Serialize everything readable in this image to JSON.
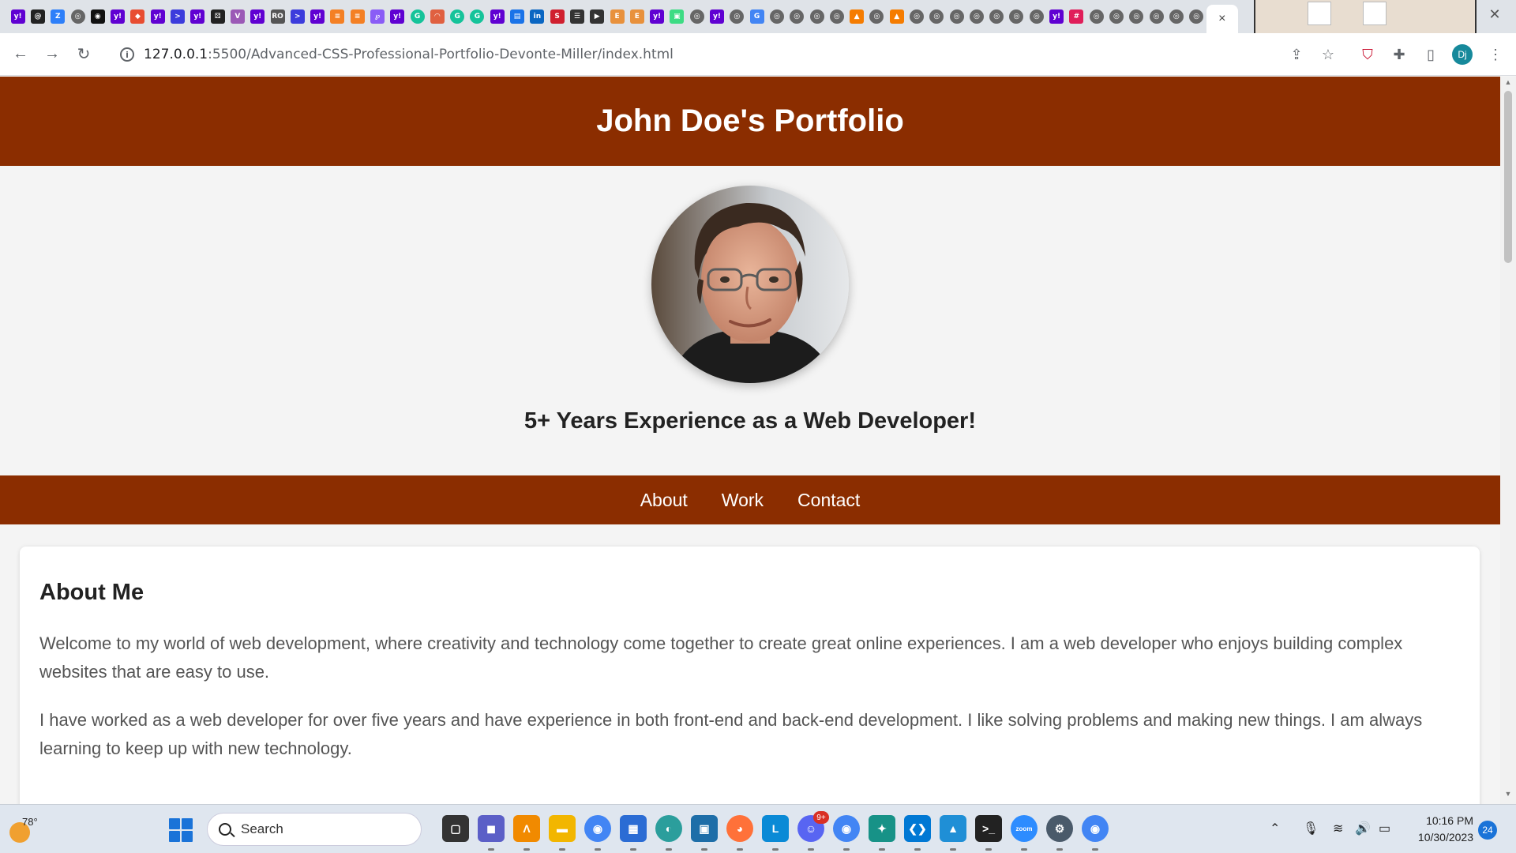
{
  "browser": {
    "tab_close_glyph": "×",
    "window_close_glyph": "✕",
    "url_host": "127.0.0.1",
    "url_path": ":5500/Advanced-CSS-Professional-Portfolio-Devonte-Miller/index.html",
    "profile_initials": "Dj",
    "tab_favicons": [
      {
        "icon": "yahoo-icon",
        "color": "#6001d2",
        "glyph": "y!"
      },
      {
        "icon": "spiral-icon",
        "color": "#222222",
        "glyph": "@"
      },
      {
        "icon": "z-icon",
        "color": "#2d7ff9",
        "glyph": "Z"
      },
      {
        "icon": "globe-icon",
        "color": "#666666",
        "glyph": "◎"
      },
      {
        "icon": "github-icon",
        "color": "#111111",
        "glyph": "◉"
      },
      {
        "icon": "yahoo-icon",
        "color": "#6001d2",
        "glyph": "y!"
      },
      {
        "icon": "git-icon",
        "color": "#e84d31",
        "glyph": "◆"
      },
      {
        "icon": "yahoo-icon",
        "color": "#6001d2",
        "glyph": "y!"
      },
      {
        "icon": "terminal-icon",
        "color": "#3c3cdc",
        "glyph": ">"
      },
      {
        "icon": "yahoo-icon",
        "color": "#6001d2",
        "glyph": "y!"
      },
      {
        "icon": "dice-icon",
        "color": "#222222",
        "glyph": "⚄"
      },
      {
        "icon": "vuetify-icon",
        "color": "#9b59b6",
        "glyph": "V"
      },
      {
        "icon": "yahoo-icon",
        "color": "#6001d2",
        "glyph": "y!"
      },
      {
        "icon": "ro-icon",
        "color": "#555555",
        "glyph": "RO"
      },
      {
        "icon": "terminal-icon",
        "color": "#3c3cdc",
        "glyph": ">"
      },
      {
        "icon": "yahoo-icon",
        "color": "#6001d2",
        "glyph": "y!"
      },
      {
        "icon": "stack-icon",
        "color": "#f48024",
        "glyph": "≡"
      },
      {
        "icon": "stack-icon",
        "color": "#f48024",
        "glyph": "≡"
      },
      {
        "icon": "regex-icon",
        "color": "#8a5cf6",
        "glyph": "℘"
      },
      {
        "icon": "yahoo-icon",
        "color": "#6001d2",
        "glyph": "y!"
      },
      {
        "icon": "grammarly-icon",
        "color": "#15c39a",
        "glyph": "G"
      },
      {
        "icon": "rainbow-icon",
        "color": "#e06040",
        "glyph": "◠"
      },
      {
        "icon": "grammarly-icon",
        "color": "#15c39a",
        "glyph": "G"
      },
      {
        "icon": "grammarly-icon",
        "color": "#15c39a",
        "glyph": "G"
      },
      {
        "icon": "yahoo-icon",
        "color": "#6001d2",
        "glyph": "y!"
      },
      {
        "icon": "doc-icon",
        "color": "#1a73e8",
        "glyph": "▤"
      },
      {
        "icon": "linkedin-icon",
        "color": "#0a66c2",
        "glyph": "in"
      },
      {
        "icon": "s-icon",
        "color": "#d0202f",
        "glyph": "S"
      },
      {
        "icon": "list-icon",
        "color": "#333333",
        "glyph": "☰"
      },
      {
        "icon": "play-icon",
        "color": "#333333",
        "glyph": "▶"
      },
      {
        "icon": "e-icon",
        "color": "#e8913c",
        "glyph": "E"
      },
      {
        "icon": "e-icon",
        "color": "#e8913c",
        "glyph": "E"
      },
      {
        "icon": "yahoo-icon",
        "color": "#6001d2",
        "glyph": "y!"
      },
      {
        "icon": "android-icon",
        "color": "#3ddc84",
        "glyph": "▣"
      },
      {
        "icon": "globe-icon",
        "color": "#666666",
        "glyph": "◎"
      },
      {
        "icon": "yahoo-icon",
        "color": "#6001d2",
        "glyph": "y!"
      },
      {
        "icon": "globe-icon",
        "color": "#666666",
        "glyph": "◎"
      },
      {
        "icon": "google-icon",
        "color": "#4285f4",
        "glyph": "G"
      },
      {
        "icon": "globe-icon",
        "color": "#666666",
        "glyph": "◎"
      },
      {
        "icon": "globe-icon",
        "color": "#666666",
        "glyph": "◎"
      },
      {
        "icon": "globe-icon",
        "color": "#666666",
        "glyph": "◎"
      },
      {
        "icon": "globe-icon",
        "color": "#666666",
        "glyph": "◎"
      },
      {
        "icon": "bell-icon",
        "color": "#f57c00",
        "glyph": "▲"
      },
      {
        "icon": "globe-icon",
        "color": "#666666",
        "glyph": "◎"
      },
      {
        "icon": "bell-icon",
        "color": "#f57c00",
        "glyph": "▲"
      },
      {
        "icon": "globe-icon",
        "color": "#666666",
        "glyph": "◎"
      },
      {
        "icon": "globe-icon",
        "color": "#666666",
        "glyph": "◎"
      },
      {
        "icon": "globe-icon",
        "color": "#666666",
        "glyph": "◎"
      },
      {
        "icon": "globe-icon",
        "color": "#666666",
        "glyph": "◎"
      },
      {
        "icon": "globe-icon",
        "color": "#666666",
        "glyph": "◎"
      },
      {
        "icon": "globe-icon",
        "color": "#666666",
        "glyph": "◎"
      },
      {
        "icon": "globe-icon",
        "color": "#666666",
        "glyph": "◎"
      },
      {
        "icon": "yahoo-icon",
        "color": "#6001d2",
        "glyph": "y!"
      },
      {
        "icon": "slack-icon",
        "color": "#e01e5a",
        "glyph": "#"
      },
      {
        "icon": "globe-icon",
        "color": "#666666",
        "glyph": "◎"
      },
      {
        "icon": "globe-icon",
        "color": "#666666",
        "glyph": "◎"
      },
      {
        "icon": "globe-icon",
        "color": "#666666",
        "glyph": "◎"
      },
      {
        "icon": "globe-icon",
        "color": "#666666",
        "glyph": "◎"
      },
      {
        "icon": "globe-icon",
        "color": "#666666",
        "glyph": "◎"
      },
      {
        "icon": "globe-icon",
        "color": "#666666",
        "glyph": "◎"
      }
    ]
  },
  "site": {
    "title": "John Doe's Portfolio",
    "avatar_alt": "John Doe",
    "tagline": "5+ Years Experience as a Web Developer!",
    "nav": [
      {
        "label": "About"
      },
      {
        "label": "Work"
      },
      {
        "label": "Contact"
      }
    ],
    "about": {
      "heading": "About Me",
      "paragraphs": [
        "Welcome to my world of web development, where creativity and technology come together to create great online experiences. I am a web developer who enjoys building complex websites that are easy to use.",
        "I have worked as a web developer for over five years and have experience in both front-end and back-end development. I like solving problems and making new things. I am always learning to keep up with new technology."
      ]
    },
    "colors": {
      "accent": "#8b2d00",
      "page_bg": "#f4f4f4"
    }
  },
  "taskbar": {
    "weather_temp": "78°",
    "search_label": "Search",
    "clock_time": "10:16 PM",
    "clock_date": "10/30/2023",
    "notification_count": "24",
    "apps": [
      {
        "icon": "task-view-icon",
        "color": "#333333",
        "glyph": "▢"
      },
      {
        "icon": "teams-icon",
        "color": "#5b5fc7",
        "glyph": "◼"
      },
      {
        "icon": "alteryx-icon",
        "color": "#f18a00",
        "glyph": "Λ"
      },
      {
        "icon": "file-explorer-icon",
        "color": "#f2b600",
        "glyph": "▬"
      },
      {
        "icon": "chrome-icon",
        "color": "#4285f4",
        "glyph": "◉"
      },
      {
        "icon": "store-icon",
        "color": "#2b6cd4",
        "glyph": "▦"
      },
      {
        "icon": "edge-icon",
        "color": "#2b9e9c",
        "glyph": "◐"
      },
      {
        "icon": "rdp-icon",
        "color": "#1e6ea8",
        "glyph": "▣"
      },
      {
        "icon": "firefox-icon",
        "color": "#ff7139",
        "glyph": "◕"
      },
      {
        "icon": "l-icon",
        "color": "#0a8ad6",
        "glyph": "L"
      },
      {
        "icon": "discord-icon",
        "color": "#5865f2",
        "glyph": "☺"
      },
      {
        "icon": "chrome-icon",
        "color": "#4285f4",
        "glyph": "◉"
      },
      {
        "icon": "gitkraken-icon",
        "color": "#179287",
        "glyph": "✦"
      },
      {
        "icon": "vscode-icon",
        "color": "#0078d4",
        "glyph": "❮❯"
      },
      {
        "icon": "photos-icon",
        "color": "#1f8fd6",
        "glyph": "▲"
      },
      {
        "icon": "terminal-icon",
        "color": "#222222",
        "glyph": ">_"
      },
      {
        "icon": "zoom-icon",
        "color": "#2d8cff",
        "glyph": "zoom"
      },
      {
        "icon": "settings-icon",
        "color": "#4a5a6a",
        "glyph": "⚙"
      },
      {
        "icon": "chrome-icon",
        "color": "#4285f4",
        "glyph": "◉"
      }
    ],
    "discord_badge": "9+"
  }
}
